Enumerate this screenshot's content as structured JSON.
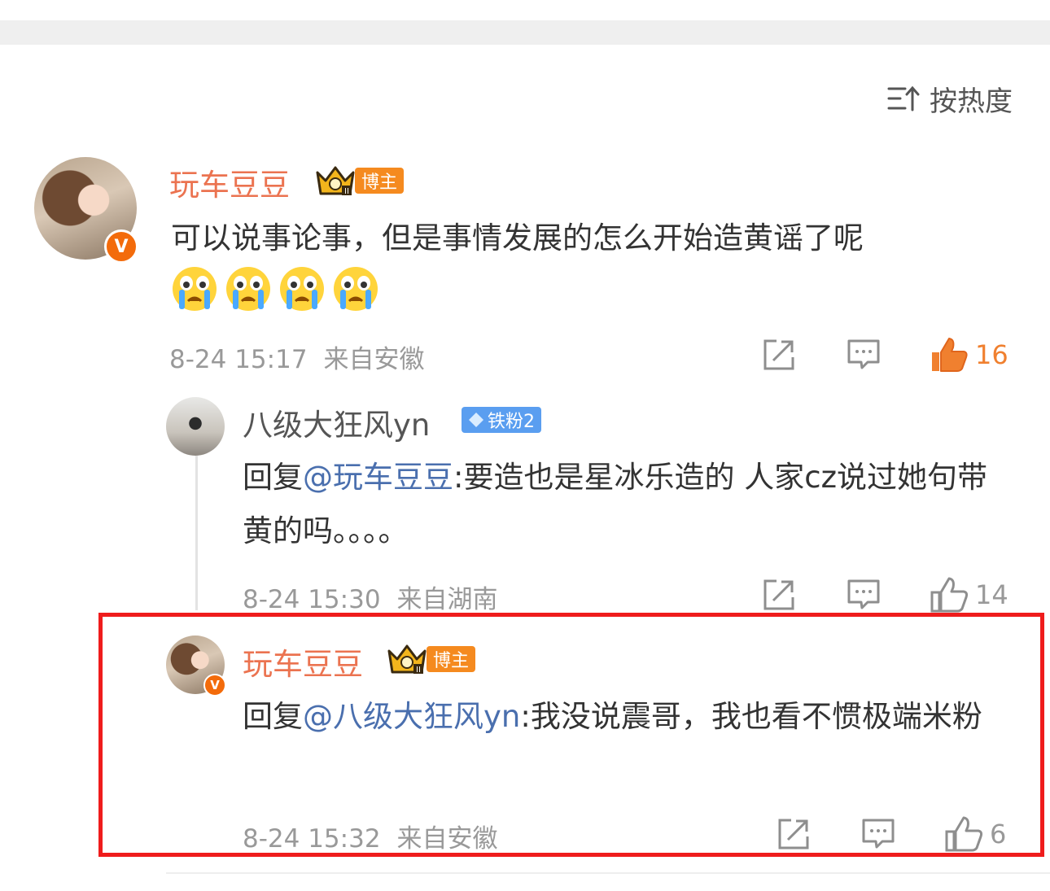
{
  "sort": {
    "label": "按热度",
    "icon": "sort-icon"
  },
  "comment": {
    "username": "玩车豆豆",
    "badge": "博主",
    "text": "可以说事论事，但是事情发展的怎么开始造黄谣了呢",
    "emoji_icons": [
      "crying-emoji",
      "crying-emoji",
      "crying-emoji",
      "crying-emoji"
    ],
    "date": "8-24 15:17",
    "location": "来自安徽",
    "likes": "16",
    "liked": true
  },
  "replies": [
    {
      "username": "八级大狂风yn",
      "badge": "铁粉2",
      "prefix": "回复",
      "mention": "@玩车豆豆",
      "text": ":要造也是星冰乐造的 人家cz说过她句带黄的吗。。。。",
      "date": "8-24 15:30",
      "location": "来自湖南",
      "likes": "14"
    },
    {
      "username": "玩车豆豆",
      "badge": "博主",
      "prefix": "回复",
      "mention": "@八级大狂风yn",
      "text": ":我没说震哥，我也看不惯极端米粉",
      "date": "8-24 15:32",
      "location": "来自安徽",
      "likes": "6"
    }
  ],
  "colors": {
    "accent": "#eb7350",
    "mention": "#4a6fae",
    "meta": "#999999",
    "highlight": "#ef1c1c",
    "host_badge": "#f58a1f",
    "fan_badge": "#5a9ef0"
  }
}
